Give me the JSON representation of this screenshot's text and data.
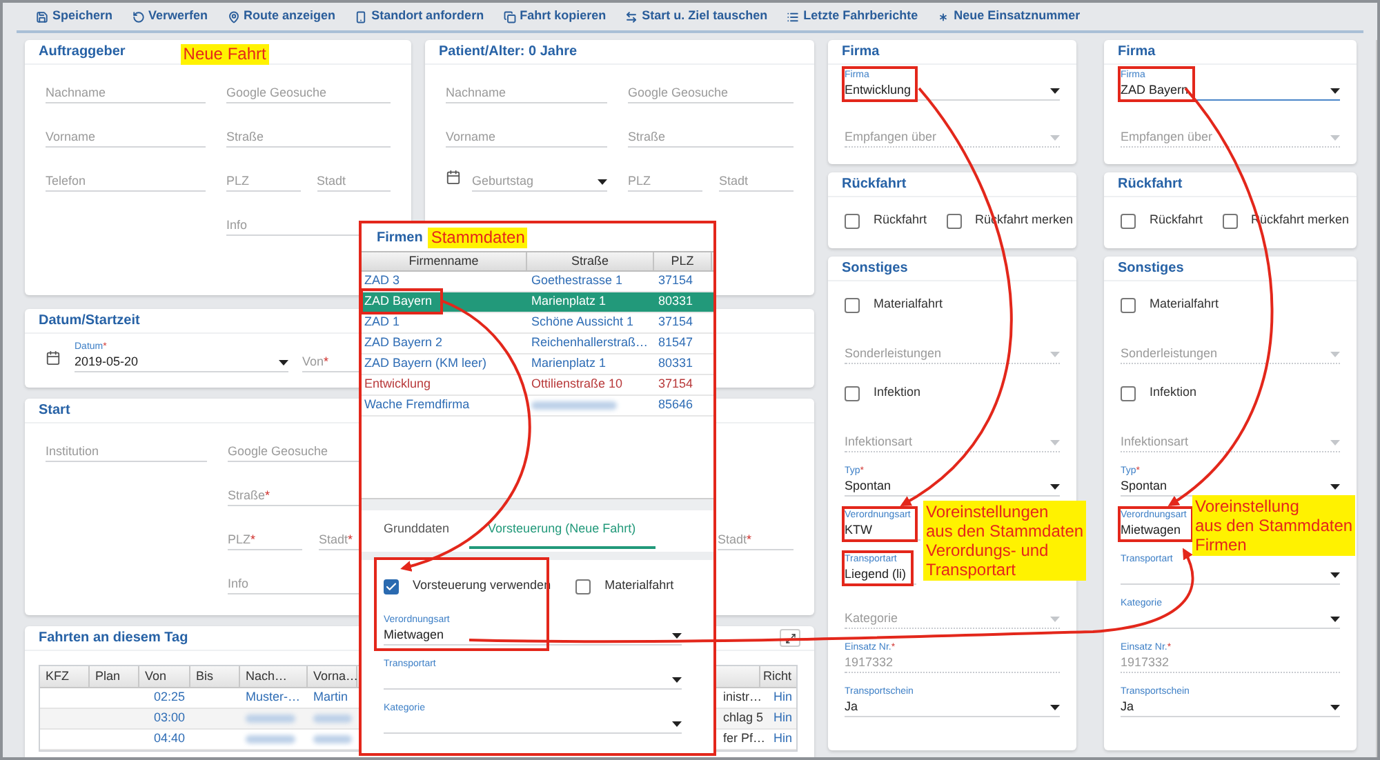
{
  "toolbar": [
    {
      "label": "Speichern"
    },
    {
      "label": "Verwerfen"
    },
    {
      "label": "Route anzeigen"
    },
    {
      "label": "Standort anfordern"
    },
    {
      "label": "Fahrt kopieren"
    },
    {
      "label": "Start u. Ziel tauschen"
    },
    {
      "label": "Letzte Fahrberichte"
    },
    {
      "label": "Neue Einsatznummer"
    }
  ],
  "auftraggeber": {
    "title": "Auftraggeber",
    "note": "Neue Fahrt",
    "rows": [
      {
        "left": [
          {
            "kind": "input",
            "placeholder": "Nachname"
          }
        ],
        "right": [
          {
            "kind": "input",
            "placeholder": "Google Geosuche"
          }
        ]
      },
      {
        "left": [
          {
            "kind": "input",
            "placeholder": "Vorname"
          }
        ],
        "right": [
          {
            "kind": "input",
            "placeholder": "Straße"
          }
        ]
      },
      {
        "left": [
          {
            "kind": "input",
            "placeholder": "Telefon"
          }
        ],
        "right": [
          {
            "kind": "input",
            "placeholder": "PLZ"
          },
          {
            "kind": "input",
            "placeholder": "Stadt"
          }
        ]
      },
      {
        "right": [
          {
            "kind": "input",
            "placeholder": "Info"
          }
        ]
      }
    ]
  },
  "patient": {
    "title": "Patient/Alter: 0 Jahre",
    "rows": [
      {
        "left": [
          {
            "kind": "input",
            "placeholder": "Nachname"
          }
        ],
        "right": [
          {
            "kind": "input",
            "placeholder": "Google Geosuche"
          }
        ]
      },
      {
        "left": [
          {
            "kind": "input",
            "placeholder": "Vorname"
          }
        ],
        "right": [
          {
            "kind": "input",
            "placeholder": "Straße"
          }
        ]
      },
      {
        "left": [
          {
            "kind": "date",
            "placeholder": "Geburtstag"
          }
        ],
        "right": [
          {
            "kind": "input",
            "placeholder": "PLZ"
          },
          {
            "kind": "input",
            "placeholder": "Stadt"
          }
        ]
      }
    ]
  },
  "datum": {
    "title": "Datum/Startzeit",
    "date": {
      "label": "Datum",
      "mark": "*",
      "value": "2019-05-20"
    },
    "time": {
      "placeholder": "Von",
      "mark": "*"
    }
  },
  "start": {
    "title": "Start",
    "rows": [
      {
        "left": [
          {
            "kind": "input",
            "placeholder": "Institution"
          }
        ],
        "right": [
          {
            "kind": "input",
            "placeholder": "Google Geosuche"
          }
        ]
      },
      {
        "right": [
          {
            "kind": "input",
            "placeholder": "Straße",
            "mark": "*"
          }
        ]
      },
      {
        "right": [
          {
            "kind": "input",
            "placeholder": "PLZ",
            "mark": "*"
          },
          {
            "kind": "input",
            "placeholder": "Stadt",
            "mark": "*"
          }
        ]
      },
      {
        "right": [
          {
            "kind": "input",
            "placeholder": "Info"
          }
        ]
      }
    ],
    "ziel_fields": [
      {
        "kind": "input",
        "placeholder": "Stadt",
        "mark": "*"
      }
    ]
  },
  "fahrten": {
    "title": "Fahrten an diesem Tag",
    "columns": [
      "KFZ",
      "Plan",
      "Von",
      "Bis",
      "Nach…",
      "Vorna…"
    ],
    "last_column": "Richt",
    "rows": [
      {
        "von": "02:25",
        "nachname": "Muster-…",
        "vorname": "Martin",
        "blurred": false,
        "column_7": "inistr…",
        "richtung": "Hin"
      },
      {
        "von": "03:00",
        "blurred": true,
        "column_7": "chlag 5",
        "richtung": "Hin"
      },
      {
        "von": "04:40",
        "blurred": true,
        "column_7": "fer Pf…",
        "richtung": "Hin"
      }
    ]
  },
  "firmen_dialog": {
    "title": "Firmen",
    "note": "Stammdaten",
    "columns": [
      "Firmenname",
      "Straße",
      "PLZ"
    ],
    "rows": [
      {
        "name": "ZAD 3",
        "street": "Goethestrasse 1",
        "plz": "37154",
        "selected": false,
        "color": "#2f6db5"
      },
      {
        "name": "ZAD Bayern",
        "street": "Marienplatz 1",
        "plz": "80331",
        "selected": true
      },
      {
        "name": "ZAD 1",
        "street": "Schöne Aussicht 1",
        "plz": "37154",
        "selected": false,
        "color": "#2f6db5"
      },
      {
        "name": "ZAD Bayern 2",
        "street": "Reichenhallerstraß…",
        "plz": "81547",
        "selected": false,
        "color": "#2f6db5"
      },
      {
        "name": "ZAD Bayern (KM leer)",
        "street": "Marienplatz 1",
        "plz": "80331",
        "selected": false,
        "color": "#2f6db5"
      },
      {
        "name": "Entwicklung",
        "street": "Ottilienstraße 10",
        "plz": "37154",
        "selected": false,
        "color": "#b8393a"
      },
      {
        "name": "Wache Fremdfirma",
        "street_blurred": true,
        "plz": "85646",
        "selected": false,
        "color": "#2f6db5"
      }
    ],
    "tabs": [
      {
        "label": "Grunddaten",
        "selected": false
      },
      {
        "label": "Vorsteuerung (Neue Fahrt)",
        "selected": true
      }
    ],
    "checkboxes": [
      {
        "label": "Vorsteuerung verwenden",
        "checked": true
      },
      {
        "label": "Materialfahrt",
        "checked": false
      }
    ],
    "fields": [
      {
        "kind": "select",
        "label": "Verordnungsart",
        "value": "Mietwagen"
      },
      {
        "kind": "select",
        "label": "Transportart"
      },
      {
        "kind": "select",
        "label": "Kategorie"
      }
    ]
  },
  "forms": [
    {
      "cards": [
        {
          "title": "Firma",
          "fields": [
            {
              "kind": "select",
              "label": "Firma",
              "value": "Entwicklung",
              "focused": false,
              "annotated": true
            },
            {
              "kind": "select",
              "placeholder": "Empfangen über",
              "disabled": true
            }
          ]
        },
        {
          "title": "Rückfahrt",
          "fields": [
            {
              "kind": "checkbox",
              "label": "Rückfahrt",
              "checked": false
            },
            {
              "kind": "checkbox",
              "label": "Rückfahrt merken",
              "checked": false
            }
          ]
        },
        {
          "title": "Sonstiges",
          "fields": [
            {
              "kind": "checkbox",
              "label": "Materialfahrt",
              "checked": false
            },
            {
              "kind": "select",
              "placeholder": "Sonderleistungen",
              "disabled": true
            },
            {
              "kind": "checkbox",
              "label": "Infektion",
              "checked": false
            },
            {
              "kind": "select",
              "placeholder": "Infektionsart",
              "disabled": true
            },
            {
              "kind": "select",
              "label": "Typ",
              "mark": "*",
              "value": "Spontan"
            },
            {
              "kind": "input",
              "label": "Verordnungsart",
              "value": "KTW",
              "annotated": true
            },
            {
              "kind": "input",
              "label": "Transportart",
              "value": "Liegend (li)",
              "annotated": true
            },
            {
              "kind": "select",
              "placeholder": "Kategorie",
              "disabled": true
            },
            {
              "kind": "input",
              "label": "Einsatz Nr.",
              "mark": "*",
              "value": "1917332",
              "disabled": true
            },
            {
              "kind": "select",
              "label": "Transportschein",
              "value": "Ja"
            }
          ]
        }
      ]
    },
    {
      "cards": [
        {
          "title": "Firma",
          "fields": [
            {
              "kind": "select",
              "label": "Firma",
              "value": "ZAD Bayern",
              "focused": true,
              "annotated": true
            },
            {
              "kind": "select",
              "placeholder": "Empfangen über",
              "disabled": true
            }
          ]
        },
        {
          "title": "Rückfahrt",
          "fields": [
            {
              "kind": "checkbox",
              "label": "Rückfahrt",
              "checked": false
            },
            {
              "kind": "checkbox",
              "label": "Rückfahrt merken",
              "checked": false
            }
          ]
        },
        {
          "title": "Sonstiges",
          "fields": [
            {
              "kind": "checkbox",
              "label": "Materialfahrt",
              "checked": false
            },
            {
              "kind": "select",
              "placeholder": "Sonderleistungen",
              "disabled": true
            },
            {
              "kind": "checkbox",
              "label": "Infektion",
              "checked": false
            },
            {
              "kind": "select",
              "placeholder": "Infektionsart",
              "disabled": true
            },
            {
              "kind": "select",
              "label": "Typ",
              "mark": "*",
              "value": "Spontan"
            },
            {
              "kind": "input",
              "label": "Verordnungsart",
              "value": "Mietwagen",
              "annotated": true
            },
            {
              "kind": "select",
              "label": "Transportart"
            },
            {
              "kind": "select",
              "label": "Kategorie"
            },
            {
              "kind": "input",
              "label": "Einsatz Nr.",
              "mark": "*",
              "value": "1917332",
              "disabled": true
            },
            {
              "kind": "select",
              "label": "Transportschein",
              "value": "Ja"
            }
          ]
        }
      ]
    }
  ],
  "notes": [
    {
      "lines": [
        "Voreinstellungen",
        "aus den Stammdaten",
        "Verordungs- und",
        "Transportart"
      ]
    },
    {
      "lines": [
        "Voreinstellung",
        "aus den Stammdaten",
        "Firmen"
      ]
    }
  ]
}
